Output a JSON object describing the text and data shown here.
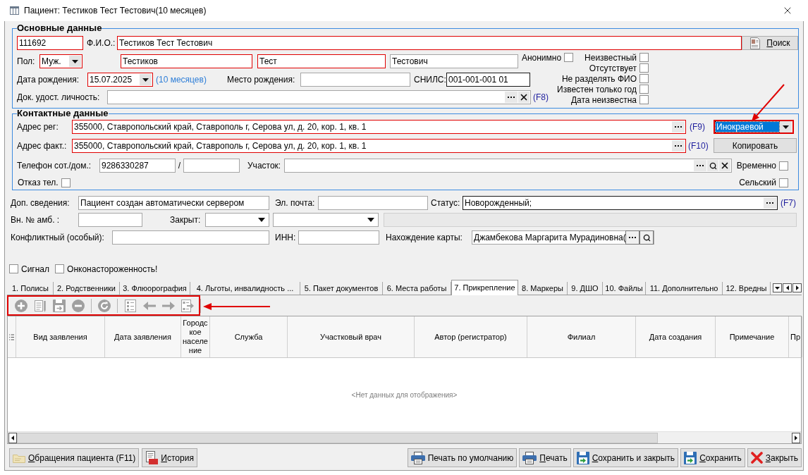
{
  "window": {
    "title": "Пациент: Тестиков Тест Тестович(10 месяцев)"
  },
  "main_data": {
    "title": "Основные данные",
    "card_number": {
      "value": "111692",
      "required": true
    },
    "full_name": {
      "label": "Ф.И.О.:",
      "value": "Тестиков Тест Тестович",
      "required": true
    },
    "search_button": {
      "label": "Поиск",
      "mnemonic": true
    },
    "sex": {
      "label": "Пол:",
      "value": "Муж.",
      "required": true
    },
    "name_parts": [
      {
        "value": "Тестиков",
        "required": true
      },
      {
        "value": "Тест",
        "required": true
      },
      {
        "value": "Тестович",
        "required": false
      }
    ],
    "birth_date": {
      "label": "Дата рождения:",
      "value": "15.07.2025",
      "required": true
    },
    "age": "(10 месяцев)",
    "birth_place": {
      "label": "Место рождения:",
      "required": false
    },
    "snils": {
      "label": "СНИЛС:",
      "value": "001-001-001 01",
      "required": false
    },
    "identity_document": {
      "label": "Док. удост. личность:",
      "required": false,
      "hotkey": "(F8)"
    },
    "flags": [
      {
        "label": "Анонимно",
        "checked": false
      },
      {
        "label": "Неизвестный",
        "checked": false
      },
      {
        "label": "Отсутствует",
        "checked": false
      },
      {
        "label": "Не разделять ФИО",
        "checked": false
      },
      {
        "label": "Известен только год",
        "checked": false
      },
      {
        "label": "Дата неизвестна",
        "checked": false
      }
    ]
  },
  "contact_data": {
    "title": "Контактные данные",
    "registered_address": {
      "label": "Адрес рег:",
      "value": "355000, Ставропольский край, Ставрополь г, Серова ул, д. 20, кор. 1, кв. 1",
      "required": true,
      "hotkey": "(F9)"
    },
    "residence_type": {
      "value": "Инокраевой",
      "required": true,
      "highlighted": true
    },
    "actual_address": {
      "label": "Адрес факт.:",
      "value": "355000, Ставропольский край, Ставрополь г, Серова ул, д. 20, кор. 1, кв. 1",
      "required": true,
      "hotkey": "(F10)"
    },
    "copy_button": {
      "label": "Копировать"
    },
    "phone": {
      "label": "Телефон сот./дом.:",
      "value": "9286330287",
      "required": false
    },
    "phone_separator": "/",
    "home_phone": {
      "required": false
    },
    "district": {
      "label": "Участок:",
      "required": false
    },
    "temporary": {
      "label": "Временно",
      "checked": false
    },
    "phone_refusal": {
      "label": "Отказ тел.",
      "checked": false
    },
    "rural": {
      "label": "Сельский",
      "checked": false
    }
  },
  "additional": {
    "notes": {
      "label": "Доп. сведения:",
      "value": "Пациент создан автоматически сервером",
      "required": false
    },
    "email": {
      "label": "Эл. почта:",
      "required": false
    },
    "status": {
      "label": "Статус:",
      "value": "Новорожденный;",
      "required": false,
      "hotkey": "(F7)"
    },
    "outpatient_number": {
      "label": "Вн. № амб. :",
      "required": false
    },
    "closed": {
      "label": "Закрыт:",
      "required": false
    },
    "closed_reason": {
      "required": false
    },
    "closed_details": {
      "disabled": true
    },
    "conflict": {
      "label": "Конфликтный (особый):",
      "required": false
    },
    "inn": {
      "label": "ИНН:",
      "required": false
    },
    "card_location": {
      "label": "Нахождение карты:",
      "value": "Джамбекова Маргарита Мурадиновна(",
      "required": false
    },
    "flags": [
      {
        "label": "Сигнал",
        "checked": false
      },
      {
        "label": "Онконастороженность!",
        "checked": false
      }
    ]
  },
  "tabs": [
    {
      "label": "1. Полисы",
      "selected": false
    },
    {
      "label": "2. Родственники",
      "selected": false
    },
    {
      "label": "3. Флюорография",
      "selected": false
    },
    {
      "label": "4. Льготы, инвалидность ...",
      "selected": false
    },
    {
      "label": "5. Пакет документов",
      "selected": false
    },
    {
      "label": "6. Места работы",
      "selected": false
    },
    {
      "label": "7. Прикрепление",
      "selected": true
    },
    {
      "label": "8. Маркеры",
      "selected": false
    },
    {
      "label": "9. ДШО",
      "selected": false
    },
    {
      "label": "10. Файлы",
      "selected": false
    },
    {
      "label": "11. Дополнительно",
      "selected": false
    },
    {
      "label": "12. Вредны",
      "selected": false
    }
  ],
  "toolbar": {
    "items": [
      {
        "kind": "add",
        "disabled": true
      },
      {
        "kind": "edit",
        "disabled": true
      },
      {
        "kind": "save",
        "disabled": true
      },
      {
        "kind": "delete",
        "disabled": true
      },
      {
        "kind": "separator"
      },
      {
        "kind": "refresh",
        "disabled": true
      },
      {
        "kind": "separator"
      },
      {
        "kind": "list",
        "disabled": true
      },
      {
        "kind": "back",
        "disabled": true
      },
      {
        "kind": "forward",
        "disabled": true
      },
      {
        "kind": "list_move",
        "disabled": true
      },
      {
        "kind": "separator"
      }
    ]
  },
  "table": {
    "columns": [
      "Вид заявления",
      "Дата заявления",
      "Городское население",
      "Служба",
      "Участковый врач",
      "Автор (регистратор)",
      "Филиал",
      "Дата создания",
      "Примечание",
      "Пр"
    ],
    "empty_text": "<Нет данных для отображения>"
  },
  "footer": {
    "left_buttons": [
      {
        "label": "Обращения пациента (F11)",
        "kind": "visits",
        "mnemonic": true
      },
      {
        "label": "История",
        "kind": "history",
        "mnemonic": true
      }
    ],
    "right_buttons": [
      {
        "label": "Печать по умолчанию",
        "kind": "print",
        "mnemonic": false
      },
      {
        "label": "Печать",
        "kind": "print",
        "mnemonic": true
      },
      {
        "label": "Сохранить и закрыть",
        "kind": "save",
        "mnemonic": true
      },
      {
        "label": "Сохранить",
        "kind": "save",
        "mnemonic": true
      },
      {
        "label": "Закрыть",
        "kind": "close",
        "mnemonic": true
      }
    ]
  }
}
